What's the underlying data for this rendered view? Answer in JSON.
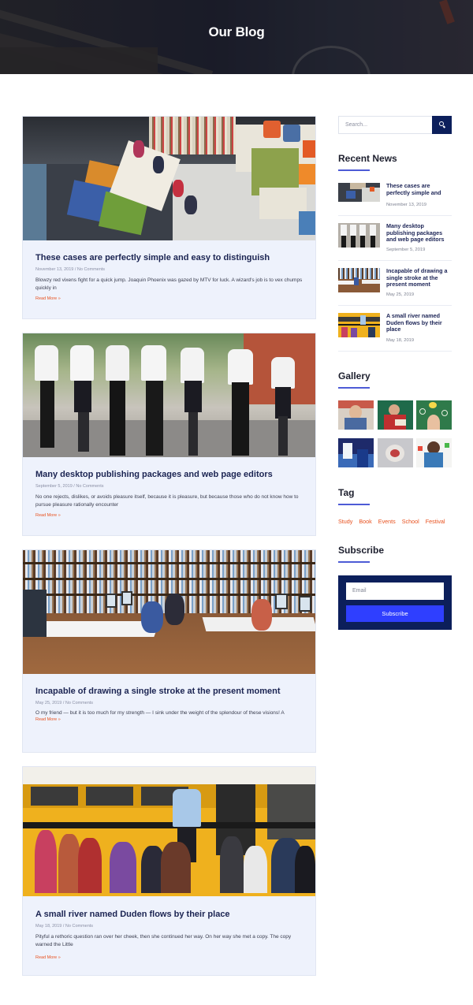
{
  "hero": {
    "title": "Our Blog"
  },
  "posts": [
    {
      "title": "These cases are perfectly simple and easy to distinguish",
      "meta": "November 13, 2019 / No Comments",
      "excerpt": "Blowzy red vixens fight for a quick jump. Joaquin Phoenix was gazed by MTV for luck. A wizard's job is to vex chumps quickly in",
      "more": "Read More »"
    },
    {
      "title": "Many desktop publishing packages and web page editors",
      "meta": "September 5, 2019 / No Comments",
      "excerpt": "No one rejects, dislikes, or avoids pleasure itself, because it is pleasure, but because those who do not know how to pursue pleasure rationally encounter",
      "more": "Read More »"
    },
    {
      "title": "Incapable of drawing a single stroke at the present moment",
      "meta": "May 25, 2019 / No Comments",
      "excerpt": "O my friend — but it is too much for my strength — I sink under the weight of the splendour of these visions! A",
      "more": "Read More »"
    },
    {
      "title": "A small river named Duden flows by their place",
      "meta": "May 18, 2019 / No Comments",
      "excerpt": "Pityful a rethoric question ran over her cheek, then she continued her way. On her way she met a copy. The copy warned the Little",
      "more": "Read More »"
    }
  ],
  "sidebar": {
    "search_placeholder": "Search...",
    "recent_heading": "Recent News",
    "recent": [
      {
        "title": "These cases are perfectly simple and",
        "date": "November 13, 2019"
      },
      {
        "title": "Many desktop publishing packages and web page editors",
        "date": "September 5, 2019"
      },
      {
        "title": "Incapable of drawing a single stroke at the present moment",
        "date": "May 25, 2019"
      },
      {
        "title": "A small river named Duden flows by their place",
        "date": "May 18, 2019"
      }
    ],
    "gallery_heading": "Gallery",
    "tag_heading": "Tag",
    "tags": [
      "Study",
      "Book",
      "Events",
      "School",
      "Festival"
    ],
    "subscribe_heading": "Subscribe",
    "email_placeholder": "Email",
    "subscribe_button": "Subscribe"
  },
  "colors": {
    "accent": "#e8511e",
    "navy": "#0c1f5b",
    "button_blue": "#2f3fff",
    "card_bg": "#eef2fc"
  }
}
